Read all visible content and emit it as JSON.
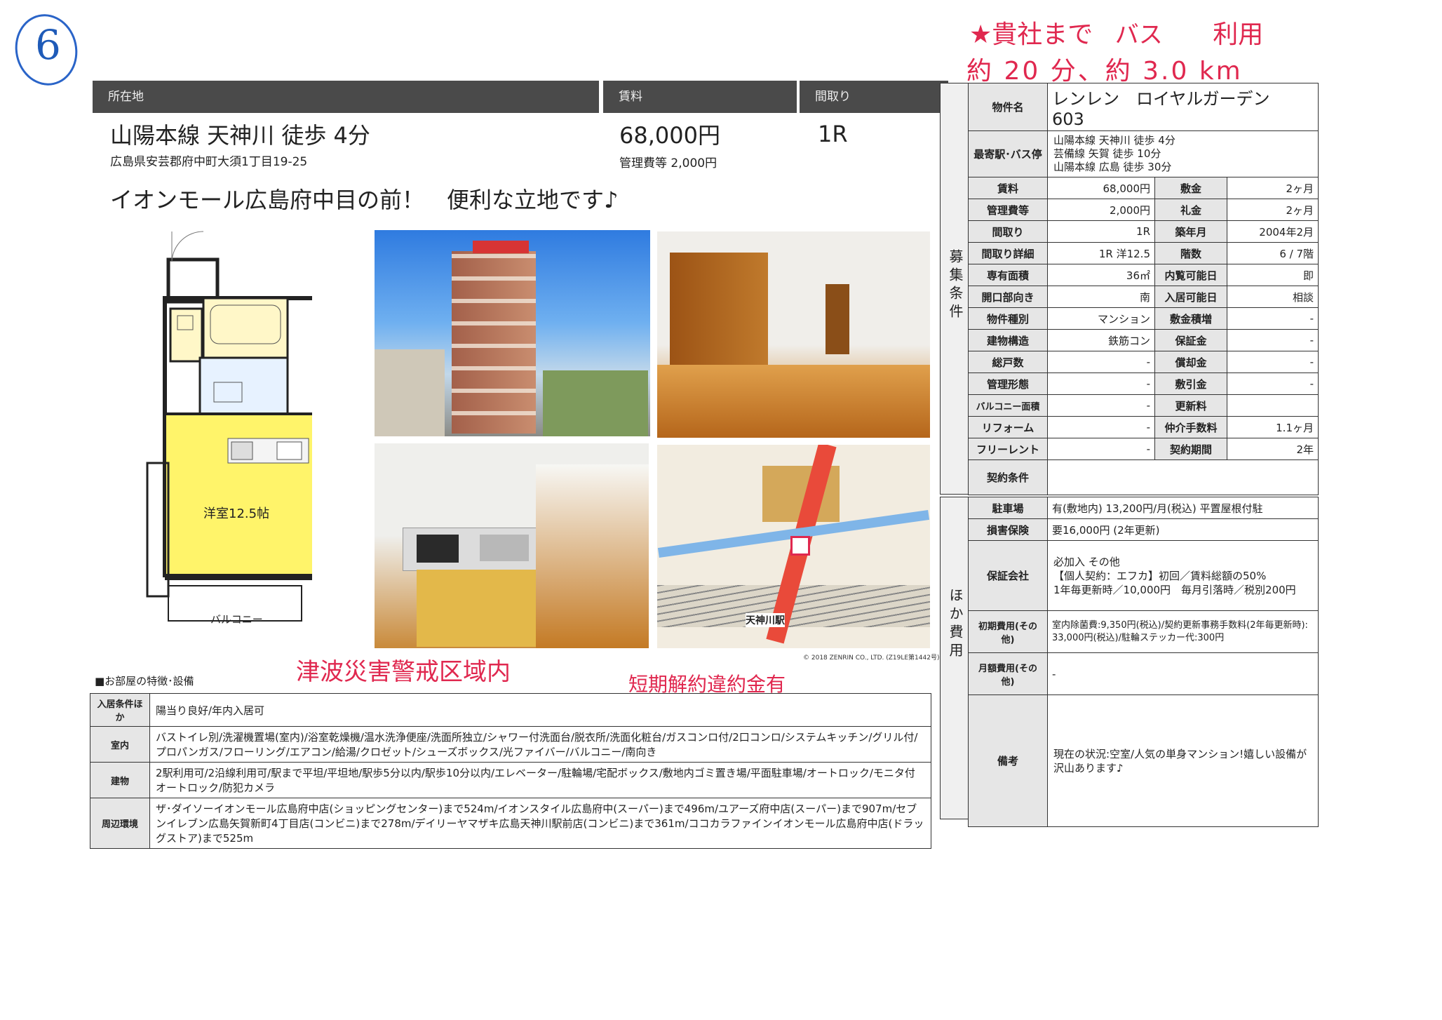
{
  "annotations": {
    "circled_number": "6",
    "note_line1_star": "★貴社まで",
    "note_line1_bus": "バス",
    "note_line1_use": "利用",
    "note_line2": "約 20 分、約 3.0 km",
    "tsunami": "津波災害警戒区域内",
    "penalty": "短期解約違約金有"
  },
  "header": {
    "location_label": "所在地",
    "rent_label": "賃料",
    "layout_label": "間取り",
    "station": "山陽本線 天神川 徒歩 4分",
    "address": "広島県安芸郡府中町大須1丁目19-25",
    "rent": "68,000円",
    "mgmt_fee": "管理費等 2,000円",
    "layout": "1R",
    "catch": "イオンモール広島府中目の前！　便利な立地です♪"
  },
  "floorplan": {
    "room_label": "洋室12.5帖",
    "balcony_label": "バルコニー"
  },
  "map": {
    "station_label": "天神川駅",
    "copyright": "© 2018 ZENRIN CO., LTD. (Z19LE第1442号)"
  },
  "property": {
    "name_label": "物件名",
    "name": "レンレン　ロイヤルガーデン　603",
    "station_label": "最寄駅･バス停",
    "stations": [
      "山陽本線 天神川 徒歩 4分",
      "芸備線 矢賀 徒歩 10分",
      "山陽本線 広島 徒歩 30分"
    ],
    "section_label": "募集条件",
    "rows": [
      [
        "賃料",
        "68,000円",
        "敷金",
        "2ヶ月"
      ],
      [
        "管理費等",
        "2,000円",
        "礼金",
        "2ヶ月"
      ],
      [
        "間取り",
        "1R",
        "築年月",
        "2004年2月"
      ],
      [
        "間取り詳細",
        "1R 洋12.5",
        "階数",
        "6 / 7階"
      ],
      [
        "専有面積",
        "36㎡",
        "内覧可能日",
        "即"
      ],
      [
        "開口部向き",
        "南",
        "入居可能日",
        "相談"
      ],
      [
        "物件種別",
        "マンション",
        "敷金積増",
        "-"
      ],
      [
        "建物構造",
        "鉄筋コン",
        "保証金",
        "-"
      ],
      [
        "総戸数",
        "-",
        "償却金",
        "-"
      ],
      [
        "管理形態",
        "-",
        "敷引金",
        "-"
      ],
      [
        "バルコニー面積",
        "-",
        "更新料",
        ""
      ],
      [
        "リフォーム",
        "-",
        "仲介手数料",
        "1.1ヶ月"
      ],
      [
        "フリーレント",
        "-",
        "契約期間",
        "2年"
      ]
    ],
    "contract_label": "契約条件",
    "contract_value": ""
  },
  "costs": {
    "section_label": "ほか費用",
    "parking_label": "駐車場",
    "parking": "有(敷地内) 13,200円/月(税込) 平置屋根付駐",
    "insurance_label": "損害保険",
    "insurance": "要16,000円 (2年更新)",
    "guarantor_label": "保証会社",
    "guarantor_lines": [
      "必加入 その他",
      "【個人契約：エフカ】初回／賃料総額の50%",
      "1年毎更新時／10,000円　毎月引落時／税別200円"
    ],
    "initial_label": "初期費用(その他)",
    "initial_lines": [
      "室内除菌費:9,350円(税込)/契約更新事務手数料(2年毎更新時):",
      "33,000円(税込)/駐輪ステッカー代:300円"
    ],
    "monthly_label": "月額費用(その他)",
    "monthly": "-",
    "remarks_label": "備考",
    "remarks_lines": [
      "現在の状況:空室/人気の単身マンション!嬉しい設備が",
      "沢山あります♪"
    ]
  },
  "features": {
    "title": "■お部屋の特徴･設備",
    "rows": [
      [
        "入居条件ほか",
        "陽当り良好/年内入居可"
      ],
      [
        "室内",
        "バストイレ別/洗濯機置場(室内)/浴室乾燥機/温水洗浄便座/洗面所独立/シャワー付洗面台/脱衣所/洗面化粧台/ガスコンロ付/2口コンロ/システムキッチン/グリル付/プロパンガス/フローリング/エアコン/給湯/クロゼット/シューズボックス/光ファイバー/バルコニー/南向き"
      ],
      [
        "建物",
        "2駅利用可/2沿線利用可/駅まで平坦/平坦地/駅歩5分以内/駅歩10分以内/エレベーター/駐輪場/宅配ボックス/敷地内ゴミ置き場/平面駐車場/オートロック/モニタ付オートロック/防犯カメラ"
      ],
      [
        "周辺環境",
        "ザ･ダイソーイオンモール広島府中店(ショッピングセンター)まで524m/イオンスタイル広島府中(スーパー)まで496m/ユアーズ府中店(スーパー)まで907m/セブンイレブン広島矢賀新町4丁目店(コンビニ)まで278m/デイリーヤマザキ広島天神川駅前店(コンビニ)まで361m/ココカラファインイオンモール広島府中店(ドラッグストア)まで525m"
      ]
    ]
  }
}
